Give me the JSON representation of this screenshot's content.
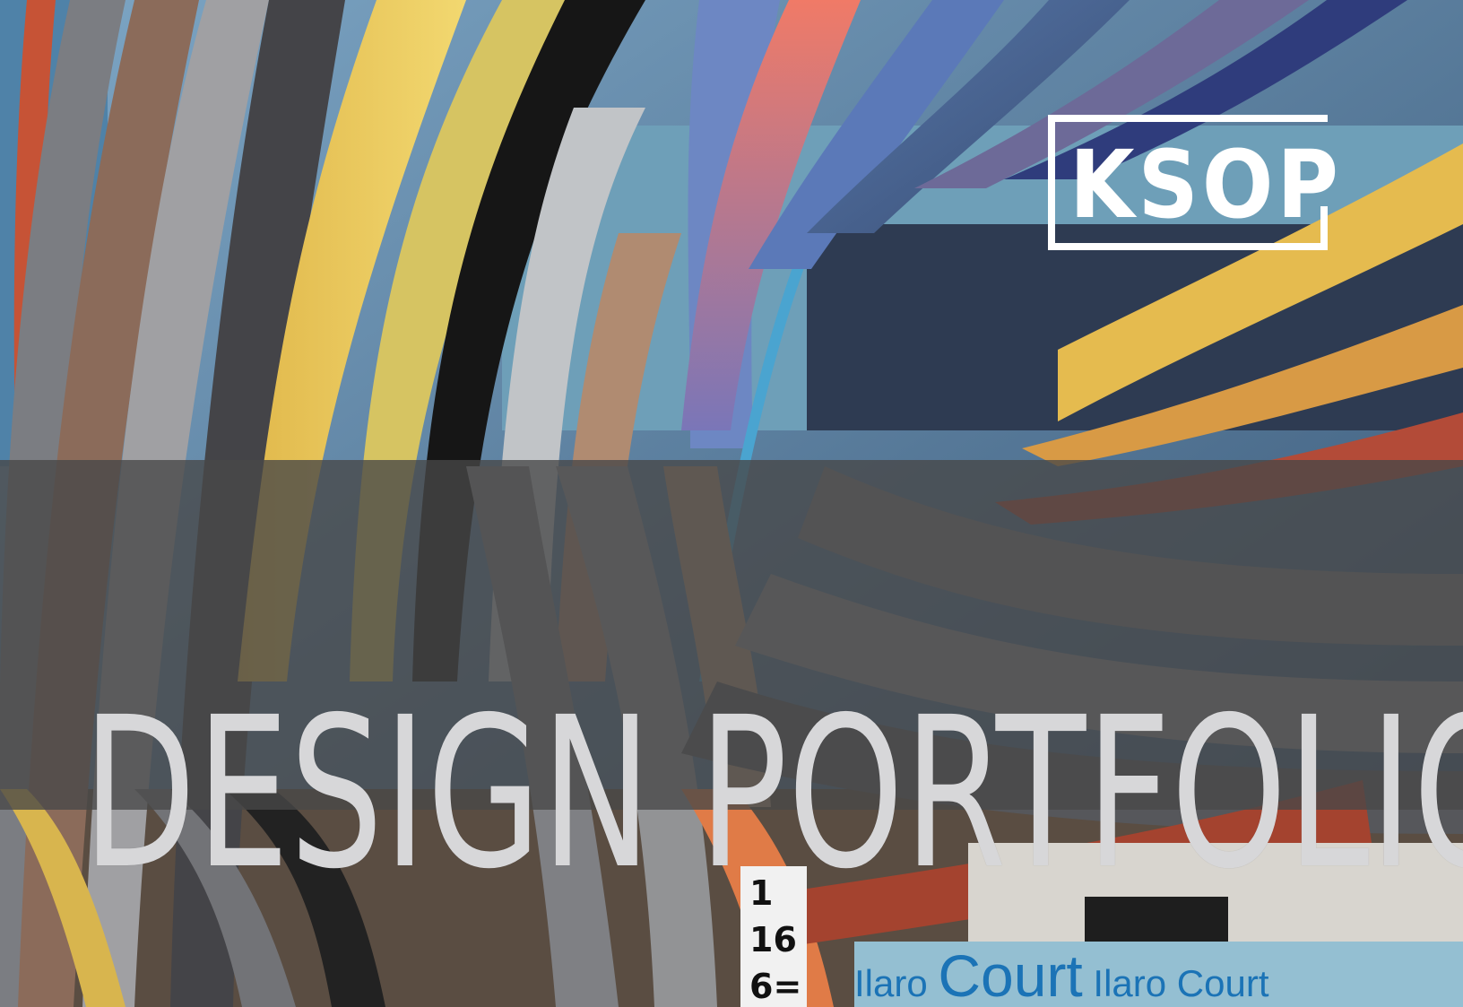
{
  "logo": {
    "text": "KSOP"
  },
  "title": {
    "text": "DESIGN PORTFOLIO"
  },
  "court_strip": {
    "text_1": "Ilaro ",
    "text_2": "Court",
    "text_3": " Ilaro Court"
  },
  "numbers": {
    "n1": "1",
    "n2": "16",
    "n3": "6="
  },
  "colors": {
    "title": "#d7d7d9",
    "logo": "#ffffff",
    "band": "#484848",
    "accent_blue": "#1b73b6"
  }
}
